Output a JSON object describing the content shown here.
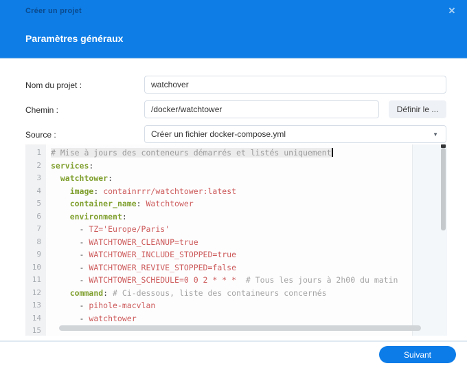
{
  "colors": {
    "header_blue": "#0e7de6",
    "accent_blue": "#0c7ce8",
    "key_green": "#7f9f2d",
    "value_red": "#cd5a5a",
    "comment_grey": "#a3a3a3"
  },
  "dialog": {
    "title": "Créer un projet",
    "close_icon": "✕",
    "section_title": "Paramètres généraux"
  },
  "form": {
    "name": {
      "label": "Nom du projet :",
      "value": "watchover"
    },
    "path": {
      "label": "Chemin :",
      "value": "/docker/watchtower",
      "button_label": "Définir le ..."
    },
    "source": {
      "label": "Source :",
      "value": "Créer un fichier docker-compose.yml",
      "caret_icon": "▼"
    }
  },
  "editor": {
    "lines": [
      {
        "num": "1",
        "cursor": true,
        "tokens": [
          [
            "comment-active",
            "# Mise à jours des conteneurs démarrés et listés uniquement"
          ]
        ]
      },
      {
        "num": "2",
        "tokens": [
          [
            "key",
            "services"
          ],
          [
            "plain",
            ":"
          ]
        ]
      },
      {
        "num": "3",
        "tokens": [
          [
            "plain",
            "  "
          ],
          [
            "key",
            "watchtower"
          ],
          [
            "plain",
            ":"
          ]
        ]
      },
      {
        "num": "4",
        "tokens": [
          [
            "plain",
            "    "
          ],
          [
            "key",
            "image"
          ],
          [
            "plain",
            ": "
          ],
          [
            "value",
            "containrrr/watchtower:latest"
          ]
        ]
      },
      {
        "num": "5",
        "tokens": [
          [
            "plain",
            "    "
          ],
          [
            "key",
            "container_name"
          ],
          [
            "plain",
            ": "
          ],
          [
            "value",
            "Watchtower"
          ]
        ]
      },
      {
        "num": "6",
        "tokens": [
          [
            "plain",
            "    "
          ],
          [
            "key",
            "environment"
          ],
          [
            "plain",
            ":"
          ]
        ]
      },
      {
        "num": "7",
        "tokens": [
          [
            "plain",
            "      - "
          ],
          [
            "value",
            "TZ='Europe/Paris'"
          ]
        ]
      },
      {
        "num": "8",
        "tokens": [
          [
            "plain",
            "      - "
          ],
          [
            "value",
            "WATCHTOWER_CLEANUP=true"
          ]
        ]
      },
      {
        "num": "9",
        "tokens": [
          [
            "plain",
            "      - "
          ],
          [
            "value",
            "WATCHTOWER_INCLUDE_STOPPED=true"
          ]
        ]
      },
      {
        "num": "10",
        "tokens": [
          [
            "plain",
            "      - "
          ],
          [
            "value",
            "WATCHTOWER_REVIVE_STOPPED=false"
          ]
        ]
      },
      {
        "num": "11",
        "tokens": [
          [
            "plain",
            "      - "
          ],
          [
            "value",
            "WATCHTOWER_SCHEDULE=0 0 2 * * *"
          ],
          [
            "comment",
            "  # Tous les jours à 2h00 du matin"
          ]
        ]
      },
      {
        "num": "12",
        "tokens": [
          [
            "plain",
            "    "
          ],
          [
            "key",
            "command"
          ],
          [
            "plain",
            ": "
          ],
          [
            "comment",
            "# Ci-dessous, liste des containeurs concernés"
          ]
        ]
      },
      {
        "num": "13",
        "tokens": [
          [
            "plain",
            "      - "
          ],
          [
            "value",
            "pihole-macvlan"
          ]
        ]
      },
      {
        "num": "14",
        "tokens": [
          [
            "plain",
            "      - "
          ],
          [
            "value",
            "watchtower"
          ]
        ]
      },
      {
        "num": "15",
        "tokens": []
      }
    ]
  },
  "footer": {
    "next_label": "Suivant"
  }
}
